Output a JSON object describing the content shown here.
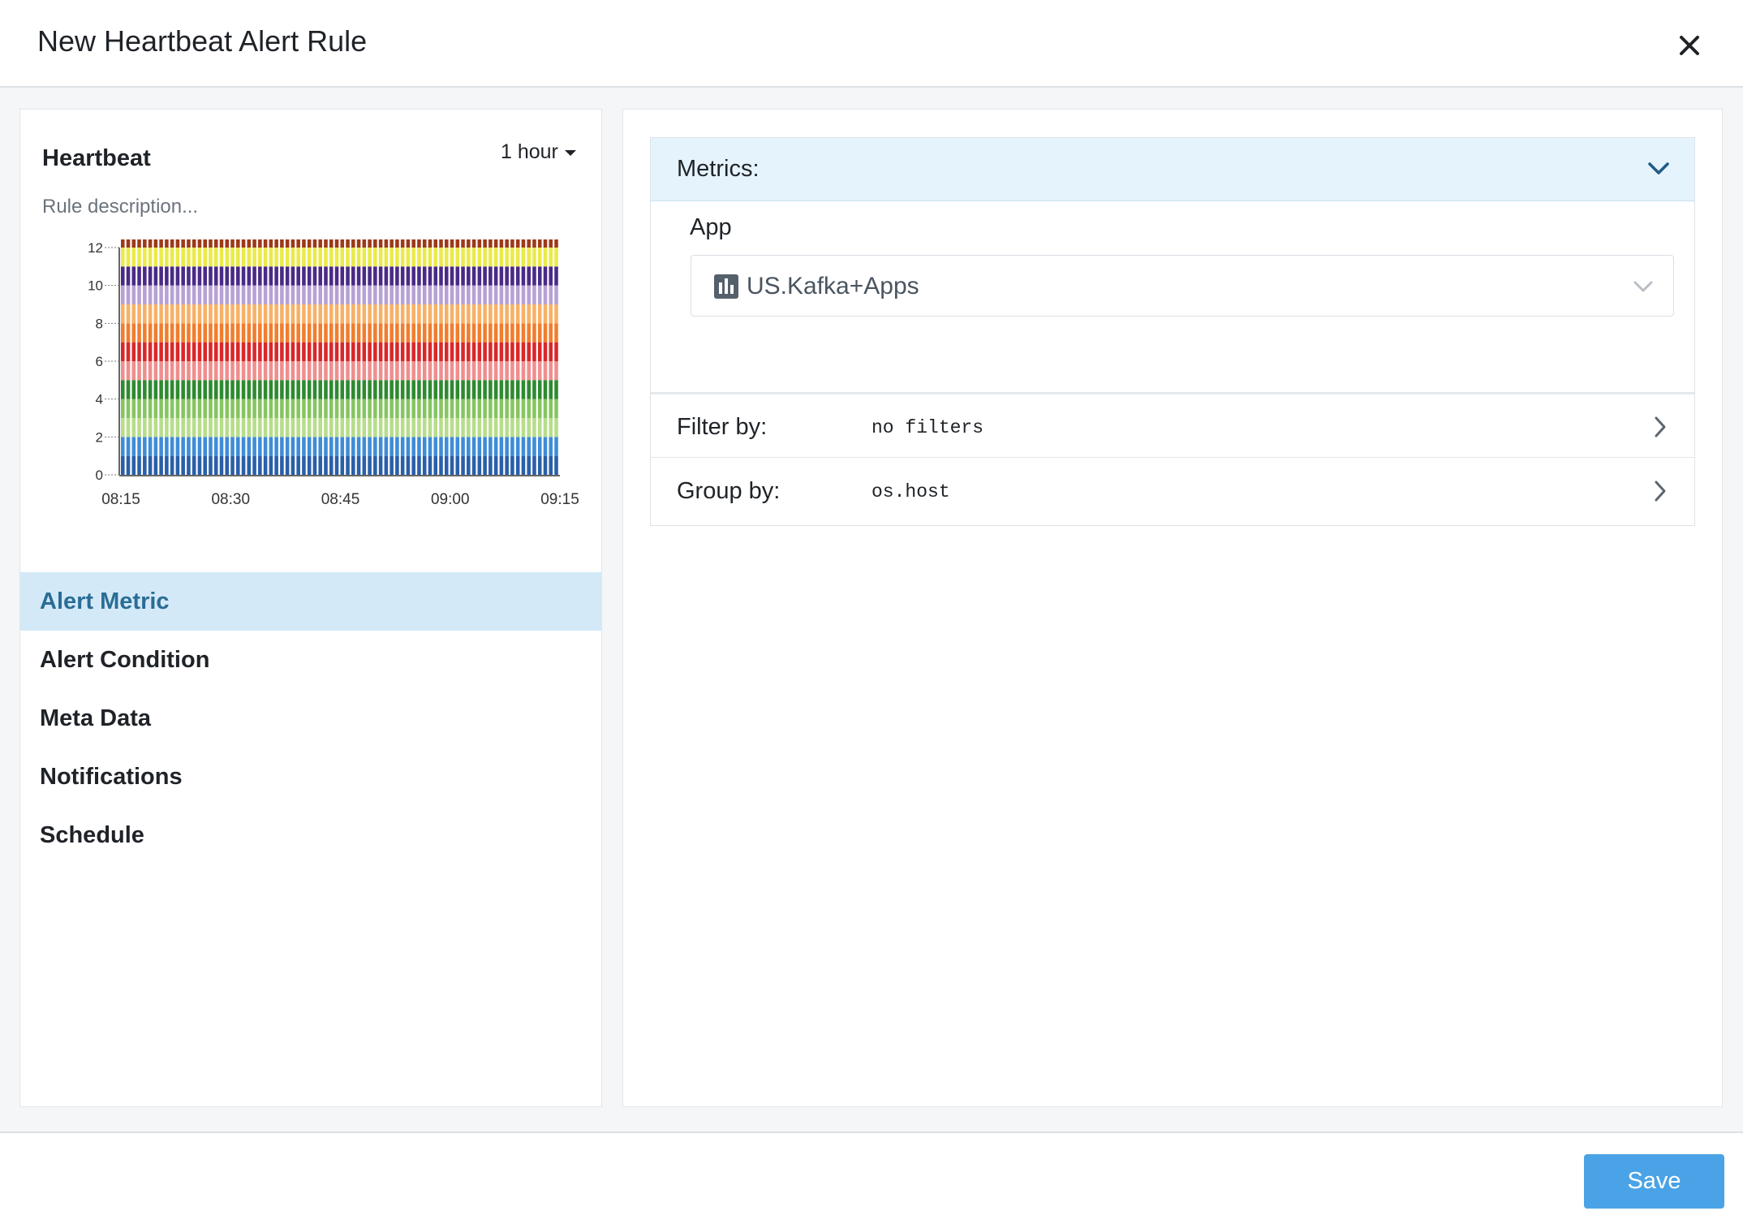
{
  "dialog": {
    "title": "New Heartbeat Alert Rule",
    "close_icon": "close-icon"
  },
  "chart_panel": {
    "title": "Heartbeat",
    "time_range": "1 hour",
    "description_placeholder": "Rule description..."
  },
  "chart_data": {
    "type": "bar",
    "stacked": true,
    "bar_count": 80,
    "x_ticks": [
      "08:15",
      "08:30",
      "08:45",
      "09:00",
      "09:15"
    ],
    "y_ticks": [
      "0",
      "2",
      "4",
      "6",
      "8",
      "10",
      "12"
    ],
    "ylim": [
      0,
      12
    ],
    "segment_value": 1,
    "segment_colors": [
      "#2a5fa8",
      "#3f8cd6",
      "#b7dd8b",
      "#86c561",
      "#2f8a30",
      "#ef8e8e",
      "#d9282a",
      "#f07e2e",
      "#f7b167",
      "#b7a1d4",
      "#4a2a86",
      "#eaea4a",
      "#9c3a1a",
      "#3ea83a"
    ]
  },
  "nav": {
    "items": [
      {
        "label": "Alert Metric",
        "active": true
      },
      {
        "label": "Alert Condition",
        "active": false
      },
      {
        "label": "Meta Data",
        "active": false
      },
      {
        "label": "Notifications",
        "active": false
      },
      {
        "label": "Schedule",
        "active": false
      }
    ]
  },
  "metrics": {
    "header": "Metrics:",
    "app_label": "App",
    "app_value": "US.Kafka+Apps",
    "filter_label": "Filter by:",
    "filter_value": "no filters",
    "group_label": "Group by:",
    "group_value": "os.host"
  },
  "footer": {
    "save_label": "Save"
  },
  "colors": {
    "accent": "#4aa3e6",
    "nav_active_bg": "#d4e9f7",
    "nav_active_text": "#2a6d96",
    "metrics_header_bg": "#e5f3fc"
  }
}
